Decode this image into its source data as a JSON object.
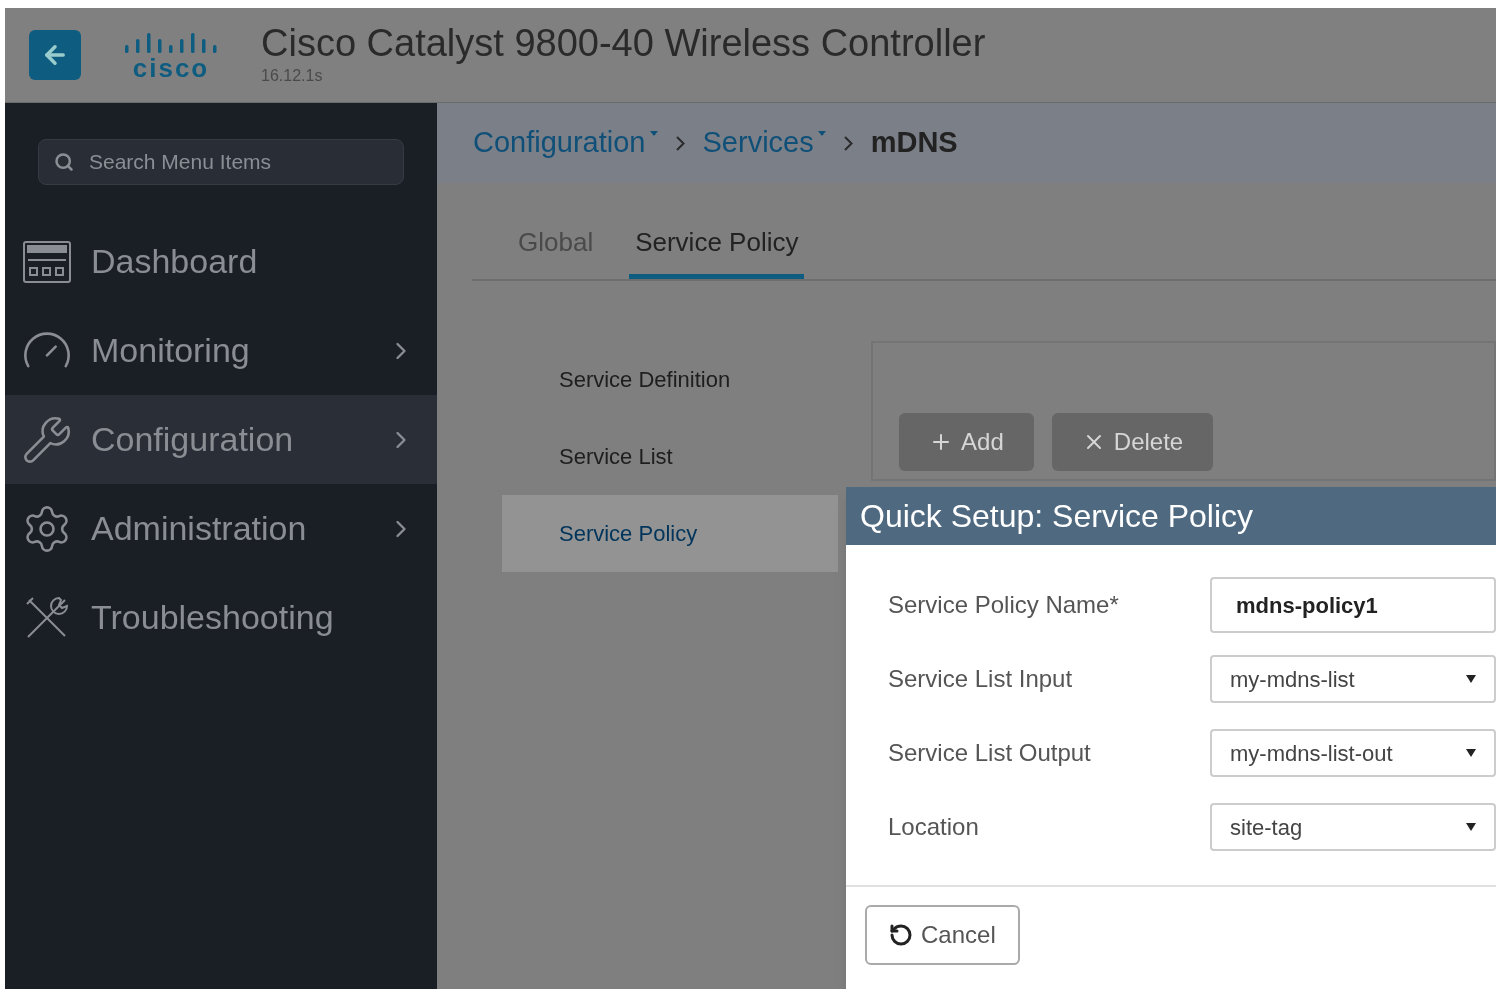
{
  "header": {
    "logo_text": "cisco",
    "title": "Cisco Catalyst 9800-40 Wireless Controller",
    "version": "16.12.1s"
  },
  "sidebar": {
    "search_placeholder": "Search Menu Items",
    "items": [
      {
        "label": "Dashboard",
        "selected": false,
        "has_submenu": false
      },
      {
        "label": "Monitoring",
        "selected": false,
        "has_submenu": true
      },
      {
        "label": "Configuration",
        "selected": true,
        "has_submenu": true
      },
      {
        "label": "Administration",
        "selected": false,
        "has_submenu": true
      },
      {
        "label": "Troubleshooting",
        "selected": false,
        "has_submenu": false
      }
    ]
  },
  "breadcrumb": [
    {
      "label": "Configuration",
      "dropdown": true
    },
    {
      "label": "Services",
      "dropdown": true
    },
    {
      "label": "mDNS",
      "dropdown": false
    }
  ],
  "tabs": [
    {
      "label": "Global",
      "selected": false
    },
    {
      "label": "Service Policy",
      "selected": true
    }
  ],
  "submenu": [
    {
      "label": "Service Definition",
      "selected": false
    },
    {
      "label": "Service List",
      "selected": false
    },
    {
      "label": "Service Policy",
      "selected": true
    }
  ],
  "toolbar": [
    {
      "label": "Add",
      "kind": "add",
      "disabled": true
    },
    {
      "label": "Delete",
      "kind": "delete",
      "disabled": true
    }
  ],
  "dialog": {
    "title": "Quick Setup: Service Policy",
    "fields": [
      {
        "label": "Service Policy Name*",
        "kind": "text",
        "value": "mdns-policy1"
      },
      {
        "label": "Service List Input",
        "kind": "select",
        "value": "my-mdns-list"
      },
      {
        "label": "Service List Output",
        "kind": "select",
        "value": "my-mdns-list-out"
      },
      {
        "label": "Location",
        "kind": "select",
        "value": "site-tag"
      }
    ],
    "buttons": [
      {
        "label": "Cancel",
        "kind": "cancel"
      }
    ]
  }
}
